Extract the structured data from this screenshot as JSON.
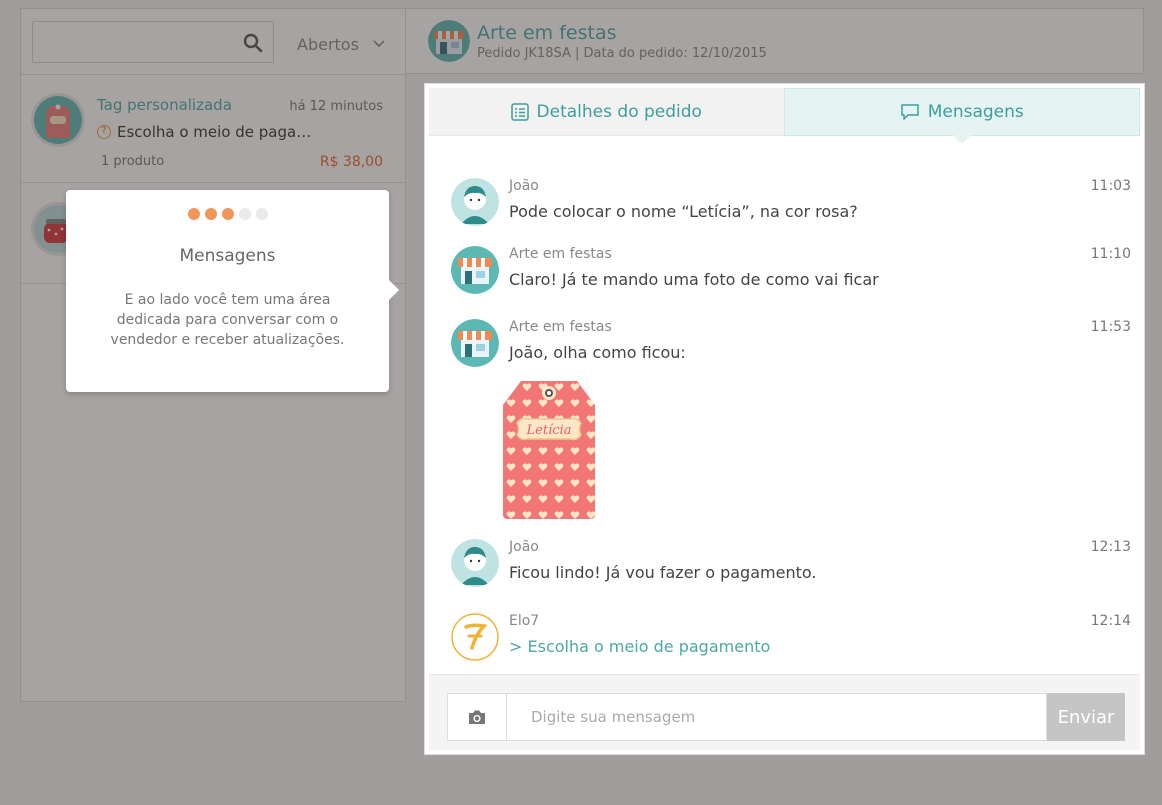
{
  "sidebar": {
    "search_placeholder": "",
    "filter_label": "Abertos",
    "orders": [
      {
        "title": "Tag personalizada",
        "time": "há 12 minutos",
        "status": "Escolha o meio de paga…",
        "qty": "1 produto",
        "price": "R$ 38,00"
      }
    ]
  },
  "header": {
    "store_name": "Arte em festas",
    "order_meta": "Pedido JK18SA | Data do pedido: 12/10/2015"
  },
  "tabs": [
    {
      "label": "Detalhes do pedido",
      "icon": "list-icon"
    },
    {
      "label": "Mensagens",
      "icon": "chat-bubble-icon"
    }
  ],
  "messages": [
    {
      "sender": "João",
      "time": "11:03",
      "text": "Pode colocar o nome “Letícia”, na cor rosa?"
    },
    {
      "sender": "Arte em festas",
      "time": "11:10",
      "text": "Claro! Já te mando uma foto de como vai ficar"
    },
    {
      "sender": "Arte em festas",
      "time": "11:53",
      "text": "João, olha como ficou:",
      "image_label": "Letícia"
    },
    {
      "sender": "João",
      "time": "12:13",
      "text": "Ficou lindo! Já vou fazer o pagamento."
    },
    {
      "sender": "Elo7",
      "time": "12:14",
      "text": "> Escolha o meio de pagamento"
    }
  ],
  "composer": {
    "placeholder": "Digite sua mensagem",
    "send_label": "Enviar"
  },
  "tour": {
    "step": 3,
    "total_steps": 5,
    "title": "Mensagens",
    "body": "E ao lado você tem uma área dedicada para conversar com o vendedor e receber atualizações."
  },
  "colors": {
    "accent": "#4aa9a6",
    "price": "#e8662d",
    "tour_dot": "#f0965a",
    "overlay": "#3c3434"
  }
}
